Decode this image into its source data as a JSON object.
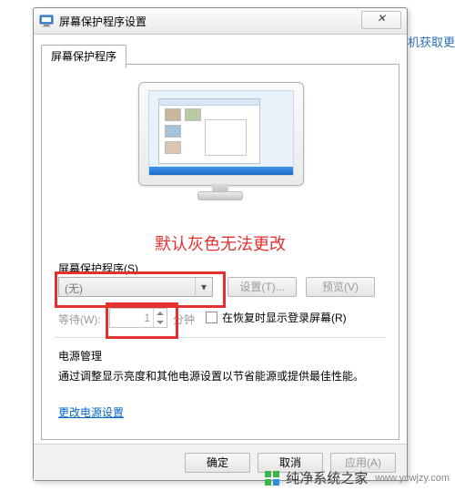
{
  "background": {
    "right_text": "机获取更"
  },
  "dialog": {
    "title": "屏幕保护程序设置",
    "close_glyph": "✕",
    "tab_label": "屏幕保护程序"
  },
  "annotation": "默认灰色无法更改",
  "screensaver": {
    "section_label": "屏幕保护程序(S)",
    "combo_value": "(无)",
    "settings_btn": "设置(T)...",
    "preview_btn": "预览(V)"
  },
  "wait": {
    "label": "等待(W):",
    "value": "1",
    "unit": "分钟",
    "checkbox_label": "在恢复时显示登录屏幕(R)"
  },
  "power": {
    "heading": "电源管理",
    "desc": "通过调整显示亮度和其他电源设置以节省能源或提供最佳性能。",
    "link": "更改电源设置"
  },
  "buttons": {
    "ok": "确定",
    "cancel": "取消",
    "apply": "应用(A)"
  },
  "watermark": {
    "name": "纯净系统之家",
    "url": "www.ycwjzy.com"
  }
}
